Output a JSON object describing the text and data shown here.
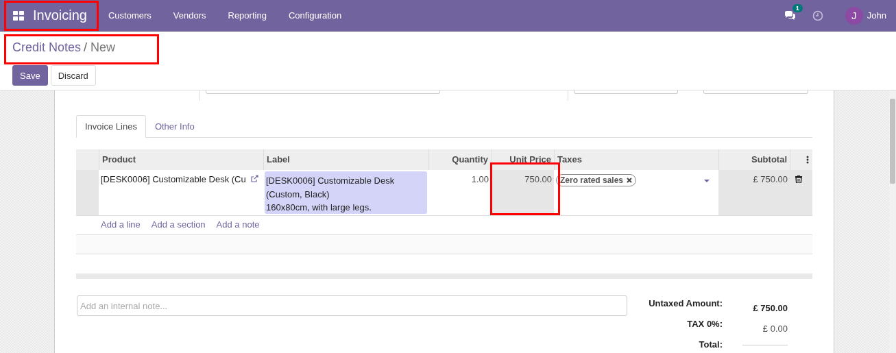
{
  "navbar": {
    "app_name": "Invoicing",
    "highlighted": true,
    "menu": [
      "Customers",
      "Vendors",
      "Reporting",
      "Configuration"
    ],
    "message_count": "1",
    "user": {
      "initial": "J",
      "name": "John"
    }
  },
  "breadcrumb": {
    "parent": "Credit Notes",
    "separator": "/",
    "current": "New",
    "highlighted": true
  },
  "buttons": [
    {
      "label": "Save",
      "kind": "primary"
    },
    {
      "label": "Discard",
      "kind": "secondary"
    }
  ],
  "tabs": [
    {
      "label": "Invoice Lines",
      "selected": true
    },
    {
      "label": "Other Info",
      "selected": false
    }
  ],
  "table": {
    "columns": [
      {
        "label": "Product"
      },
      {
        "label": "Label"
      },
      {
        "label": "Quantity"
      },
      {
        "label": "Unit Price"
      },
      {
        "label": "Taxes"
      },
      {
        "label": "Subtotal"
      }
    ],
    "rows": [
      {
        "product": "[DESK0006] Customizable Desk (Cu",
        "label": "[DESK0006] Customizable Desk\n(Custom, Black)\n160x80cm, with large legs.",
        "quantity": "1.00",
        "unit_price": "750.00",
        "unit_price_highlighted": true,
        "taxes": [
          "Zero rated sales"
        ],
        "subtotal": "£ 750.00"
      }
    ],
    "add_links": [
      "Add a line",
      "Add a section",
      "Add a note"
    ]
  },
  "note": {
    "placeholder": "Add an internal note..."
  },
  "totals": [
    {
      "label": "Untaxed Amount:",
      "value": "£ 750.00"
    },
    {
      "label": "TAX 0%:",
      "value": "£ 0.00"
    },
    {
      "label": "Total:"
    }
  ]
}
